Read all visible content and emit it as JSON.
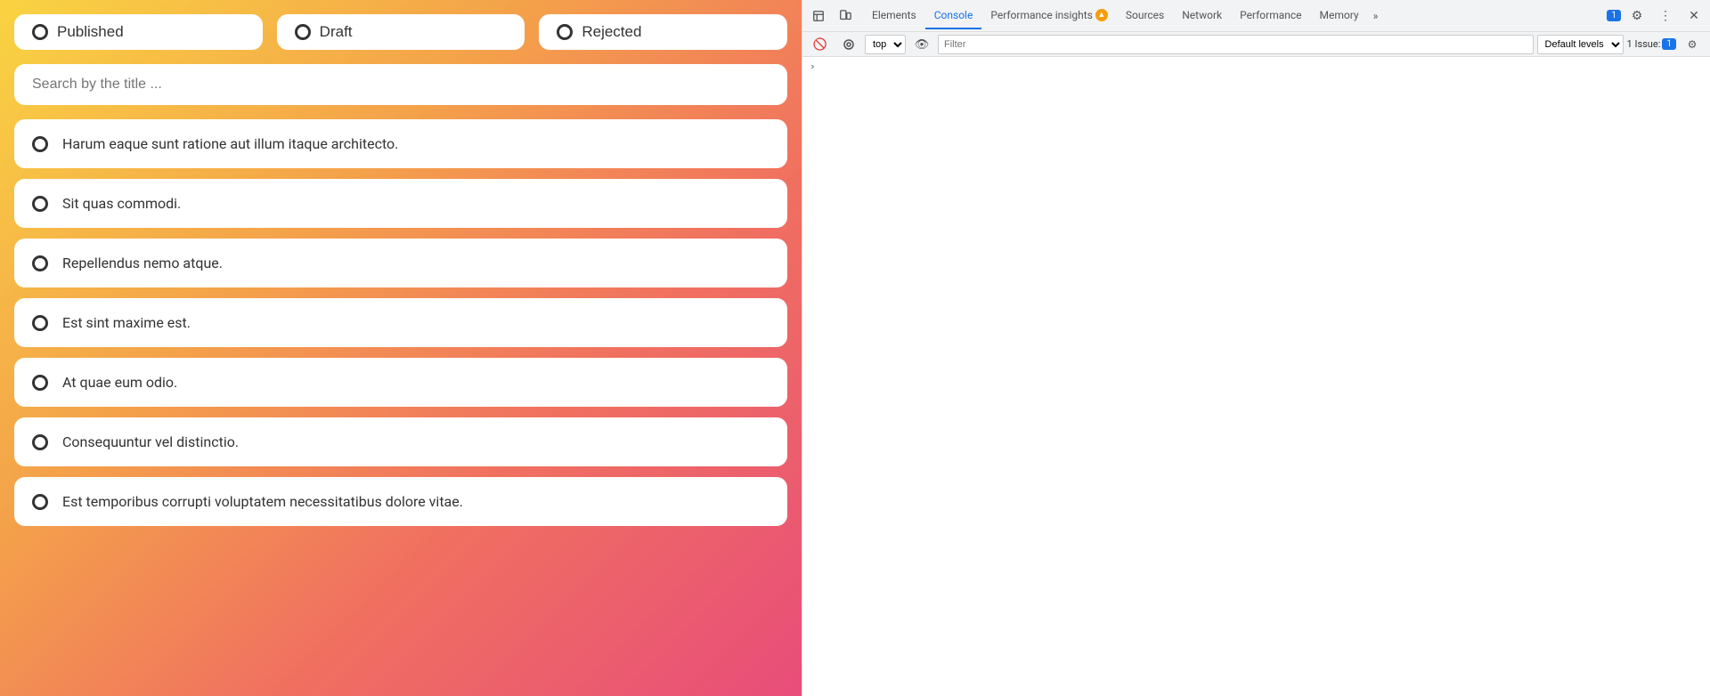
{
  "filters": [
    {
      "id": "published",
      "label": "Published",
      "dotClass": "dot-green"
    },
    {
      "id": "draft",
      "label": "Draft",
      "dotClass": "dot-yellow"
    },
    {
      "id": "rejected",
      "label": "Rejected",
      "dotClass": "dot-red"
    }
  ],
  "search": {
    "placeholder": "Search by the title ..."
  },
  "items": [
    {
      "id": 1,
      "text": "Harum eaque sunt ratione aut illum itaque architecto.",
      "dotClass": "dot-yellow"
    },
    {
      "id": 2,
      "text": "Sit quas commodi.",
      "dotClass": "dot-yellow"
    },
    {
      "id": 3,
      "text": "Repellendus nemo atque.",
      "dotClass": "dot-red"
    },
    {
      "id": 4,
      "text": "Est sint maxime est.",
      "dotClass": "dot-green"
    },
    {
      "id": 5,
      "text": "At quae eum odio.",
      "dotClass": "dot-green"
    },
    {
      "id": 6,
      "text": "Consequuntur vel distinctio.",
      "dotClass": "dot-red"
    },
    {
      "id": 7,
      "text": "Est temporibus corrupti voluptatem necessitatibus dolore vitae.",
      "dotClass": "dot-green"
    }
  ],
  "devtools": {
    "tabs": [
      {
        "label": "Elements",
        "active": false
      },
      {
        "label": "Console",
        "active": true
      },
      {
        "label": "Performance insights",
        "active": false,
        "hasWarning": true
      },
      {
        "label": "Sources",
        "active": false
      },
      {
        "label": "Network",
        "active": false
      },
      {
        "label": "Performance",
        "active": false
      },
      {
        "label": "Memory",
        "active": false
      }
    ],
    "toolbar": {
      "top_option": "top",
      "filter_placeholder": "Filter",
      "levels_label": "Default levels",
      "issues_label": "1 Issue:",
      "issues_count": "1"
    }
  }
}
